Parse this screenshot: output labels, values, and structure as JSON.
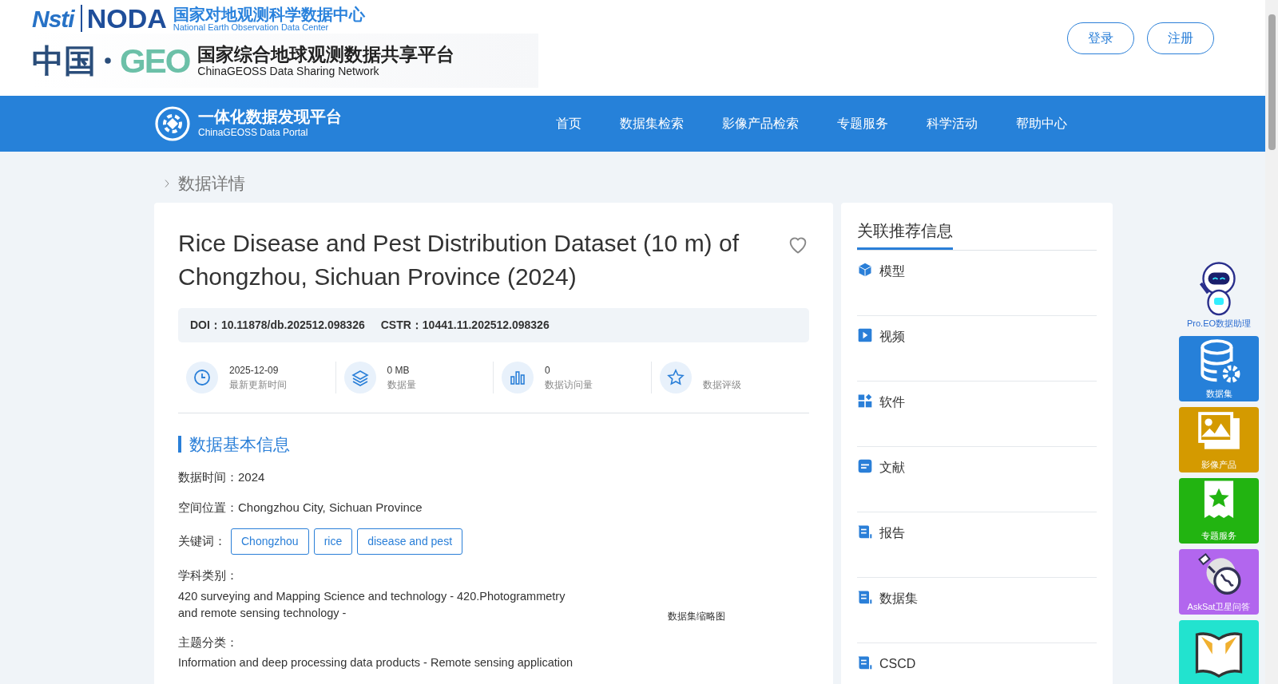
{
  "header": {
    "logo_top": {
      "mark_a": "Nsti",
      "mark_b": "NODA",
      "title": "国家对地观测科学数据中心",
      "subtitle": "National Earth Observation Data Center"
    },
    "logo_bottom": {
      "mark_a": "中国",
      "mark_b": "GEO",
      "title": "国家综合地球观测数据共享平台",
      "subtitle": "ChinaGEOSS Data Sharing Network"
    },
    "buttons": [
      "登录",
      "注册"
    ]
  },
  "navbar": {
    "brand": {
      "title": "一体化数据发现平台",
      "subtitle": "ChinaGEOSS Data Portal"
    },
    "items": [
      {
        "label": "首页",
        "selected": false
      },
      {
        "label": "数据集检索",
        "selected": false
      },
      {
        "label": "影像产品检索",
        "selected": false
      },
      {
        "label": "专题服务",
        "selected": false
      },
      {
        "label": "科学活动",
        "selected": false
      },
      {
        "label": "帮助中心",
        "selected": false
      }
    ]
  },
  "breadcrumb": "数据详情",
  "dataset": {
    "title": "Rice Disease and Pest Distribution Dataset (10 m) of Chongzhou, Sichuan Province (2024)",
    "favorite": false,
    "identifiers": [
      {
        "label": "DOI：",
        "value": "10.11878/db.202512.098326"
      },
      {
        "label": "CSTR：",
        "value": "10441.11.202512.098326"
      }
    ],
    "stats": [
      {
        "kind": "clock",
        "value": "2025-12-09",
        "label": "最新更新时间"
      },
      {
        "kind": "layers",
        "value": "0 MB",
        "label": "数据量"
      },
      {
        "kind": "bars",
        "value": "0",
        "label": "数据访问量"
      },
      {
        "kind": "star",
        "label": "数据评级"
      }
    ],
    "section_title": "数据基本信息",
    "fields": [
      {
        "kind": "inline",
        "label": "数据时间：",
        "value": "2024"
      },
      {
        "kind": "inline",
        "label": "空间位置：",
        "value": "Chongzhou City, Sichuan Province"
      },
      {
        "kind": "tags",
        "label": "关键词：",
        "tags": [
          "Chongzhou",
          "rice",
          "disease and pest"
        ]
      },
      {
        "kind": "block",
        "label": "学科类别：",
        "value": "420 surveying and Mapping Science and technology - 420.Photogrammetry and remote sensing technology -"
      },
      {
        "kind": "block",
        "label": "主题分类：",
        "value": "Information and deep processing data products - Remote sensing application"
      }
    ],
    "thumbnail_alt": "数据集缩略图"
  },
  "related": {
    "title": "关联推荐信息",
    "items": [
      {
        "kind": "cube",
        "label": "模型"
      },
      {
        "kind": "play",
        "label": "视频"
      },
      {
        "kind": "apps",
        "label": "软件"
      },
      {
        "kind": "doc",
        "label": "文献"
      },
      {
        "kind": "scroll",
        "label": "报告"
      },
      {
        "kind": "scroll",
        "label": "数据集"
      },
      {
        "kind": "scroll",
        "label": "CSCD"
      }
    ]
  },
  "float_bar": [
    {
      "kind": "robot",
      "label": "Pro.EO数据助理"
    },
    {
      "kind": "database",
      "label": "数据集",
      "color": "#2680d9"
    },
    {
      "kind": "image",
      "label": "影像产品",
      "color": "#d49a00"
    },
    {
      "kind": "bookmark",
      "label": "专题服务",
      "color": "#22b411"
    },
    {
      "kind": "satellite",
      "label": "AskSat卫星问答",
      "color": "#b266ee"
    },
    {
      "kind": "book",
      "color": "#22e3cf"
    }
  ]
}
